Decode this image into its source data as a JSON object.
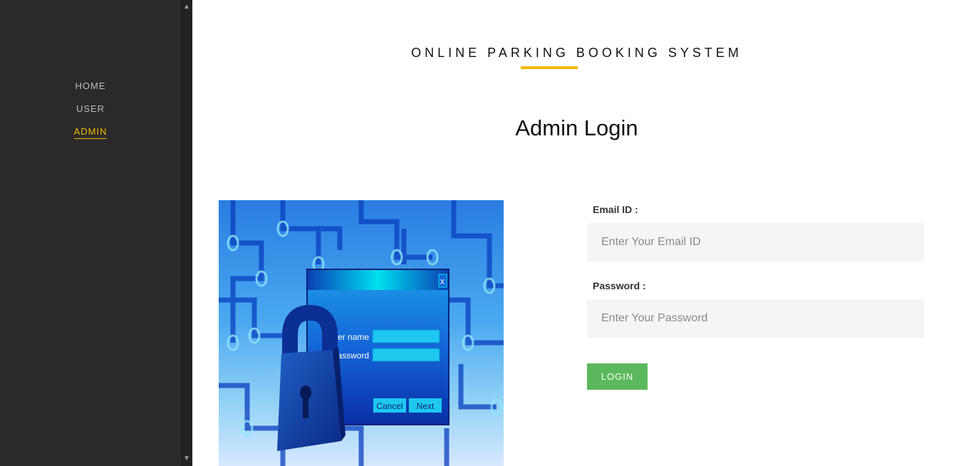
{
  "nav": {
    "items": [
      {
        "label": "HOME"
      },
      {
        "label": "USER"
      },
      {
        "label": "ADMIN"
      }
    ],
    "active_color": "#f4b800"
  },
  "header": {
    "site_title": "ONLINE PARKING BOOKING SYSTEM",
    "page_title": "Admin Login"
  },
  "illustration": {
    "username_label": "User name",
    "password_label": "Password",
    "close_label": "X",
    "cancel_label": "Cancel",
    "next_label": "Next"
  },
  "form": {
    "email_label": "Email ID :",
    "email_placeholder": "Enter Your Email ID",
    "email_value": "",
    "password_label": "Password :",
    "password_placeholder": "Enter Your Password",
    "password_value": "",
    "login_label": "LOGIN"
  },
  "colors": {
    "sidebar_bg": "#2a2a2a",
    "accent": "#f4b800",
    "button": "#5cb85c"
  }
}
